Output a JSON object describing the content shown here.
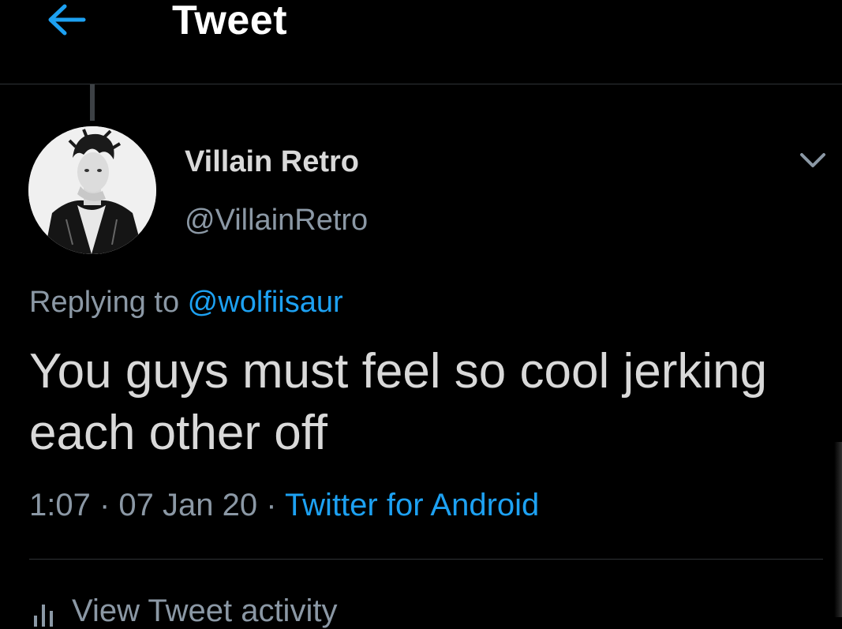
{
  "header": {
    "back_icon": "arrow-left-icon",
    "title": "Tweet"
  },
  "tweet": {
    "author": {
      "display_name": "Villain Retro",
      "handle": "@VillainRetro",
      "avatar_icon": "avatar-photo"
    },
    "menu_icon": "chevron-down-icon",
    "replying_prefix": "Replying to ",
    "replying_to": "@wolfiisaur",
    "text": "You guys must feel so cool jerking each other off",
    "time": "1:07",
    "separator": " · ",
    "date": "07 Jan 20",
    "source": "Twitter for Android"
  },
  "activity": {
    "icon": "bar-chart-icon",
    "label": "View Tweet activity"
  },
  "colors": {
    "background": "#000000",
    "accent": "#1da1f2",
    "secondary_text": "#8b98a5",
    "primary_text": "#d9d9d9",
    "divider": "#2f3336"
  }
}
